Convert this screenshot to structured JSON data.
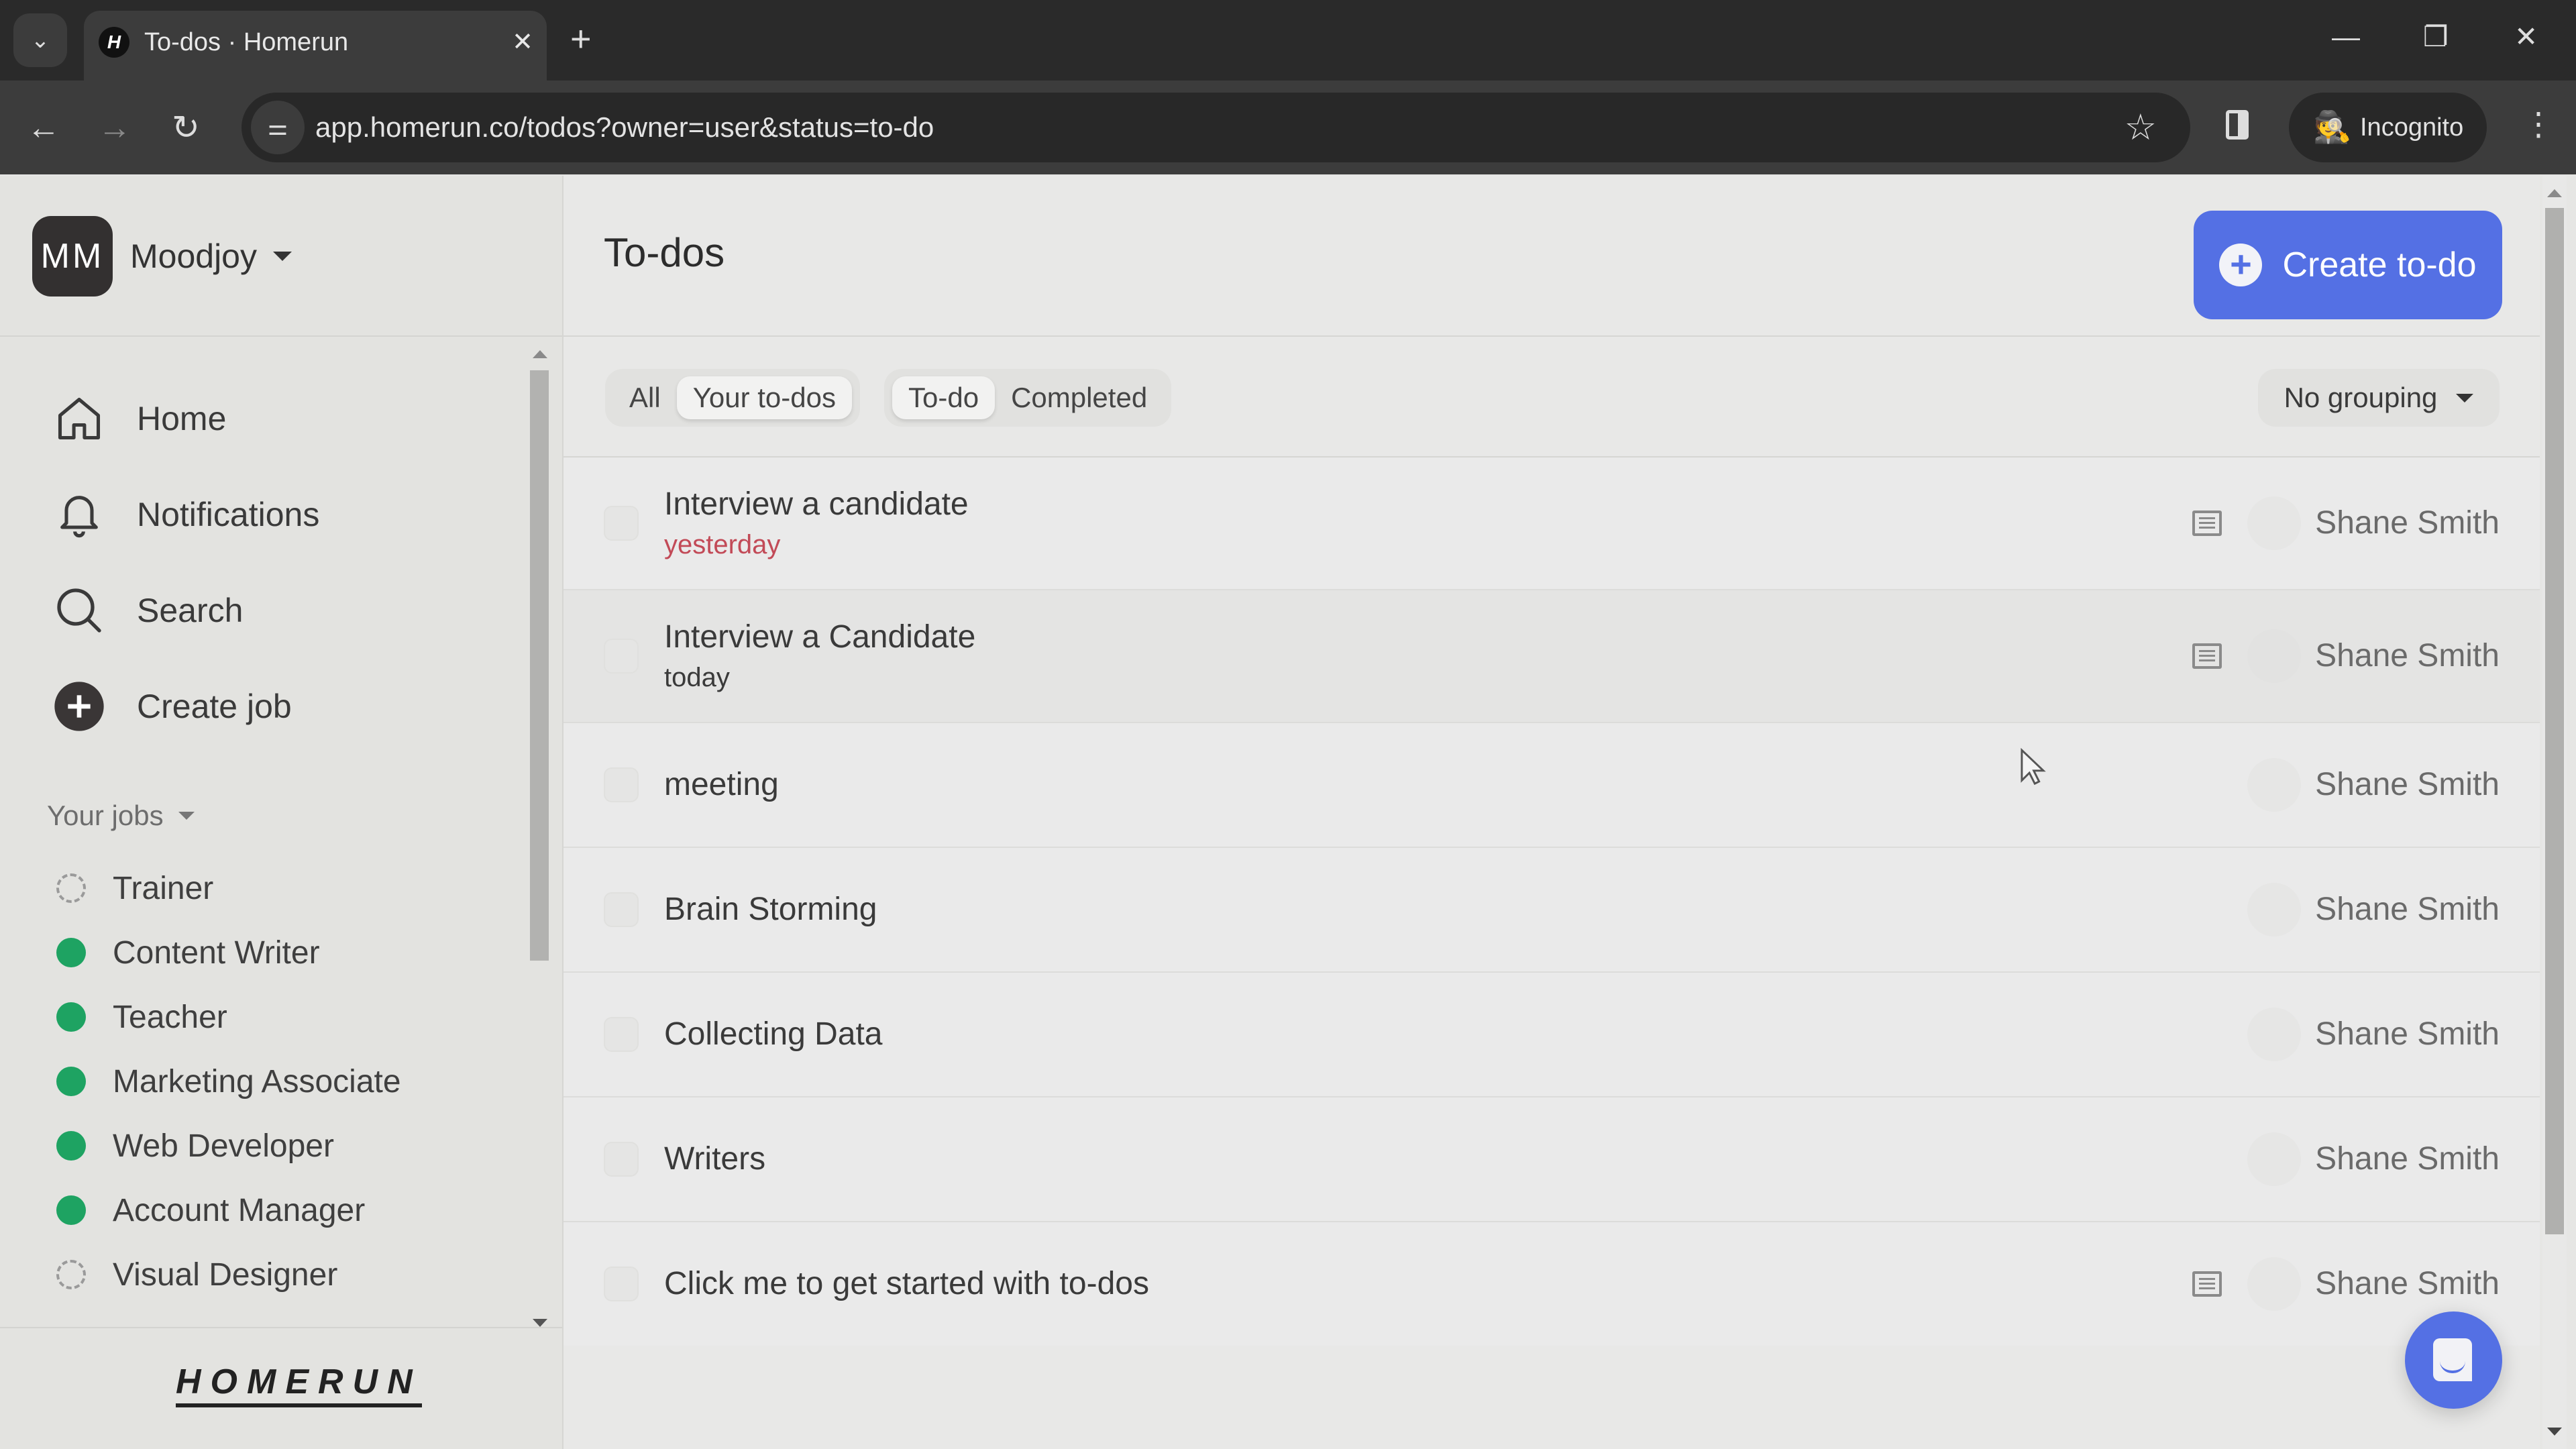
{
  "browser": {
    "tab_title": "To-dos · Homerun",
    "tab_favicon_letter": "H",
    "url": "app.homerun.co/todos?owner=user&status=to-do",
    "incognito_label": "Incognito"
  },
  "sidebar": {
    "org_initials": "MM",
    "org_name": "Moodjoy",
    "nav": [
      {
        "label": "Home",
        "icon": "home-icon"
      },
      {
        "label": "Notifications",
        "icon": "bell-icon"
      },
      {
        "label": "Search",
        "icon": "search-icon"
      },
      {
        "label": "Create job",
        "icon": "plus-circle-icon"
      }
    ],
    "jobs_heading": "Your jobs",
    "jobs": [
      {
        "label": "Trainer",
        "status": "draft"
      },
      {
        "label": "Content Writer",
        "status": "active"
      },
      {
        "label": "Teacher",
        "status": "active"
      },
      {
        "label": "Marketing Associate",
        "status": "active"
      },
      {
        "label": "Web Developer",
        "status": "active"
      },
      {
        "label": "Account Manager",
        "status": "active"
      },
      {
        "label": "Visual Designer",
        "status": "draft"
      }
    ],
    "logo_text": "HOMERUN"
  },
  "main": {
    "title": "To-dos",
    "create_button": "Create to-do",
    "owner_filter": {
      "options": [
        "All",
        "Your to-dos"
      ],
      "selected": "Your to-dos"
    },
    "status_filter": {
      "options": [
        "To-do",
        "Completed"
      ],
      "selected": "To-do"
    },
    "grouping": "No grouping",
    "todos": [
      {
        "title": "Interview a candidate",
        "due": "yesterday",
        "overdue": true,
        "has_note": true,
        "owner": "Shane Smith"
      },
      {
        "title": "Interview a Candidate",
        "due": "today",
        "overdue": false,
        "has_note": true,
        "owner": "Shane Smith"
      },
      {
        "title": "meeting",
        "due": null,
        "overdue": false,
        "has_note": false,
        "owner": "Shane Smith"
      },
      {
        "title": "Brain Storming",
        "due": null,
        "overdue": false,
        "has_note": false,
        "owner": "Shane Smith"
      },
      {
        "title": "Collecting Data",
        "due": null,
        "overdue": false,
        "has_note": false,
        "owner": "Shane Smith"
      },
      {
        "title": "Writers",
        "due": null,
        "overdue": false,
        "has_note": false,
        "owner": "Shane Smith"
      },
      {
        "title": "Click me to get started with to-dos",
        "due": null,
        "overdue": false,
        "has_note": true,
        "owner": "Shane Smith"
      }
    ]
  },
  "colors": {
    "accent": "#5470e4",
    "active_job": "#1ea362",
    "overdue": "#c24a57"
  }
}
